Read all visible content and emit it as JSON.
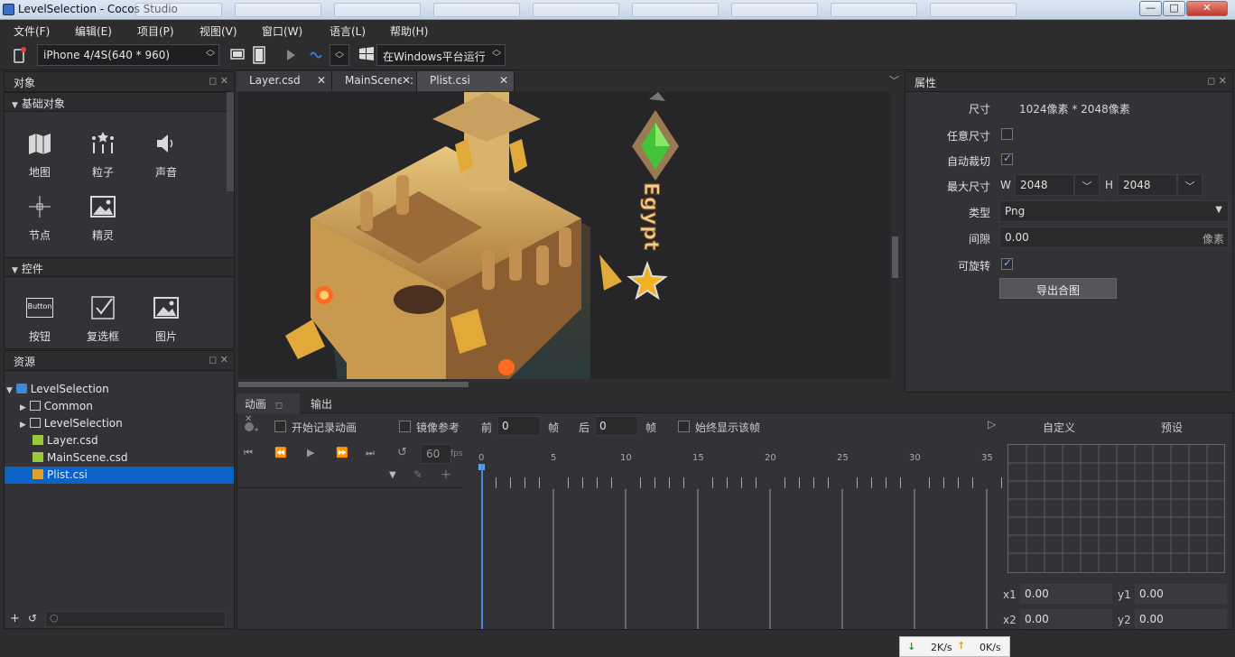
{
  "window": {
    "title": "LevelSelection - Cocos Studio",
    "min": "—",
    "max": "□",
    "close": "✕"
  },
  "menu": [
    "文件(F)",
    "编辑(E)",
    "项目(P)",
    "视图(V)",
    "窗口(W)",
    "语言(L)",
    "帮助(H)"
  ],
  "toolbar": {
    "device": "iPhone 4/4S(640 * 960)",
    "run_target": "在Windows平台运行"
  },
  "objects_panel": {
    "title": "对象",
    "section_basic": "基础对象",
    "basic_items": [
      "地图",
      "粒子",
      "声音",
      "节点",
      "精灵"
    ],
    "section_controls": "控件",
    "control_items": [
      "按钮",
      "复选框",
      "图片"
    ],
    "button_icon_text": "Button"
  },
  "resources_panel": {
    "title": "资源",
    "tree": [
      {
        "label": "LevelSelection",
        "level": 0,
        "expanded": true,
        "type": "project"
      },
      {
        "label": "Common",
        "level": 1,
        "expanded": false,
        "type": "folder"
      },
      {
        "label": "LevelSelection",
        "level": 1,
        "expanded": false,
        "type": "folder"
      },
      {
        "label": "Layer.csd",
        "level": 1,
        "type": "csd"
      },
      {
        "label": "MainScene.csd",
        "level": 1,
        "type": "csd"
      },
      {
        "label": "Plist.csi",
        "level": 1,
        "type": "csi",
        "selected": true
      }
    ]
  },
  "tabs": [
    {
      "label": "Layer.csd"
    },
    {
      "label": "MainScene.c"
    },
    {
      "label": "Plist.csi",
      "active": true
    }
  ],
  "canvas": {
    "sign_text": "Egypt"
  },
  "properties": {
    "title": "属性",
    "size_label": "尺寸",
    "size_value": "1024像素 * 2048像素",
    "any_size_label": "任意尺寸",
    "any_size_checked": false,
    "auto_crop_label": "自动裁切",
    "auto_crop_checked": true,
    "max_size_label": "最大尺寸",
    "w_label": "W",
    "w_value": "2048",
    "h_label": "H",
    "h_value": "2048",
    "type_label": "类型",
    "type_value": "Png",
    "gap_label": "间隙",
    "gap_value": "0.00",
    "gap_unit": "像素",
    "rotatable_label": "可旋转",
    "rotatable_checked": true,
    "export_button": "导出合图"
  },
  "animation": {
    "tab_anim": "动画",
    "tab_output": "输出",
    "start_record": "开始记录动画",
    "mirror": "镜像参考",
    "front_label": "前",
    "front_value": "0",
    "frame1": "帧",
    "back_label": "后",
    "back_value": "0",
    "frame2": "帧",
    "always_show": "始终显示该帧",
    "fps_value": "60",
    "fps_unit": "fps",
    "custom": "自定义",
    "preset": "预设",
    "x1_label": "x1",
    "x1_value": "0.00",
    "y1_label": "y1",
    "y1_value": "0.00",
    "x2_label": "x2",
    "x2_value": "0.00",
    "y2_label": "y2",
    "y2_value": "0.00",
    "timeline_ticks": [
      "0",
      "5",
      "10",
      "15",
      "20",
      "25",
      "30",
      "35"
    ]
  },
  "net": {
    "down": "2K/s",
    "up": "0K/s"
  },
  "colors": {
    "accent": "#0a63c5",
    "panel": "#333337",
    "bg": "#2d2d30"
  }
}
